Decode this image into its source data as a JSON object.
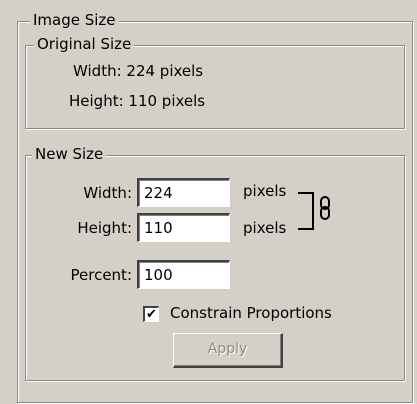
{
  "image_size": {
    "legend": "Image Size"
  },
  "original_size": {
    "legend": "Original Size",
    "width_text": "Width: 224 pixels",
    "height_text": "Height: 110 pixels"
  },
  "new_size": {
    "legend": "New Size",
    "width_label": "Width:",
    "width_value": "224",
    "width_unit": "pixels",
    "height_label": "Height:",
    "height_value": "110",
    "height_unit": "pixels",
    "percent_label": "Percent:",
    "percent_value": "100",
    "constrain_label": "Constrain Proportions",
    "constrain_checked": true,
    "check_mark": "✔",
    "apply_label": "Apply"
  },
  "icons": {
    "link": "chain-link-icon"
  }
}
